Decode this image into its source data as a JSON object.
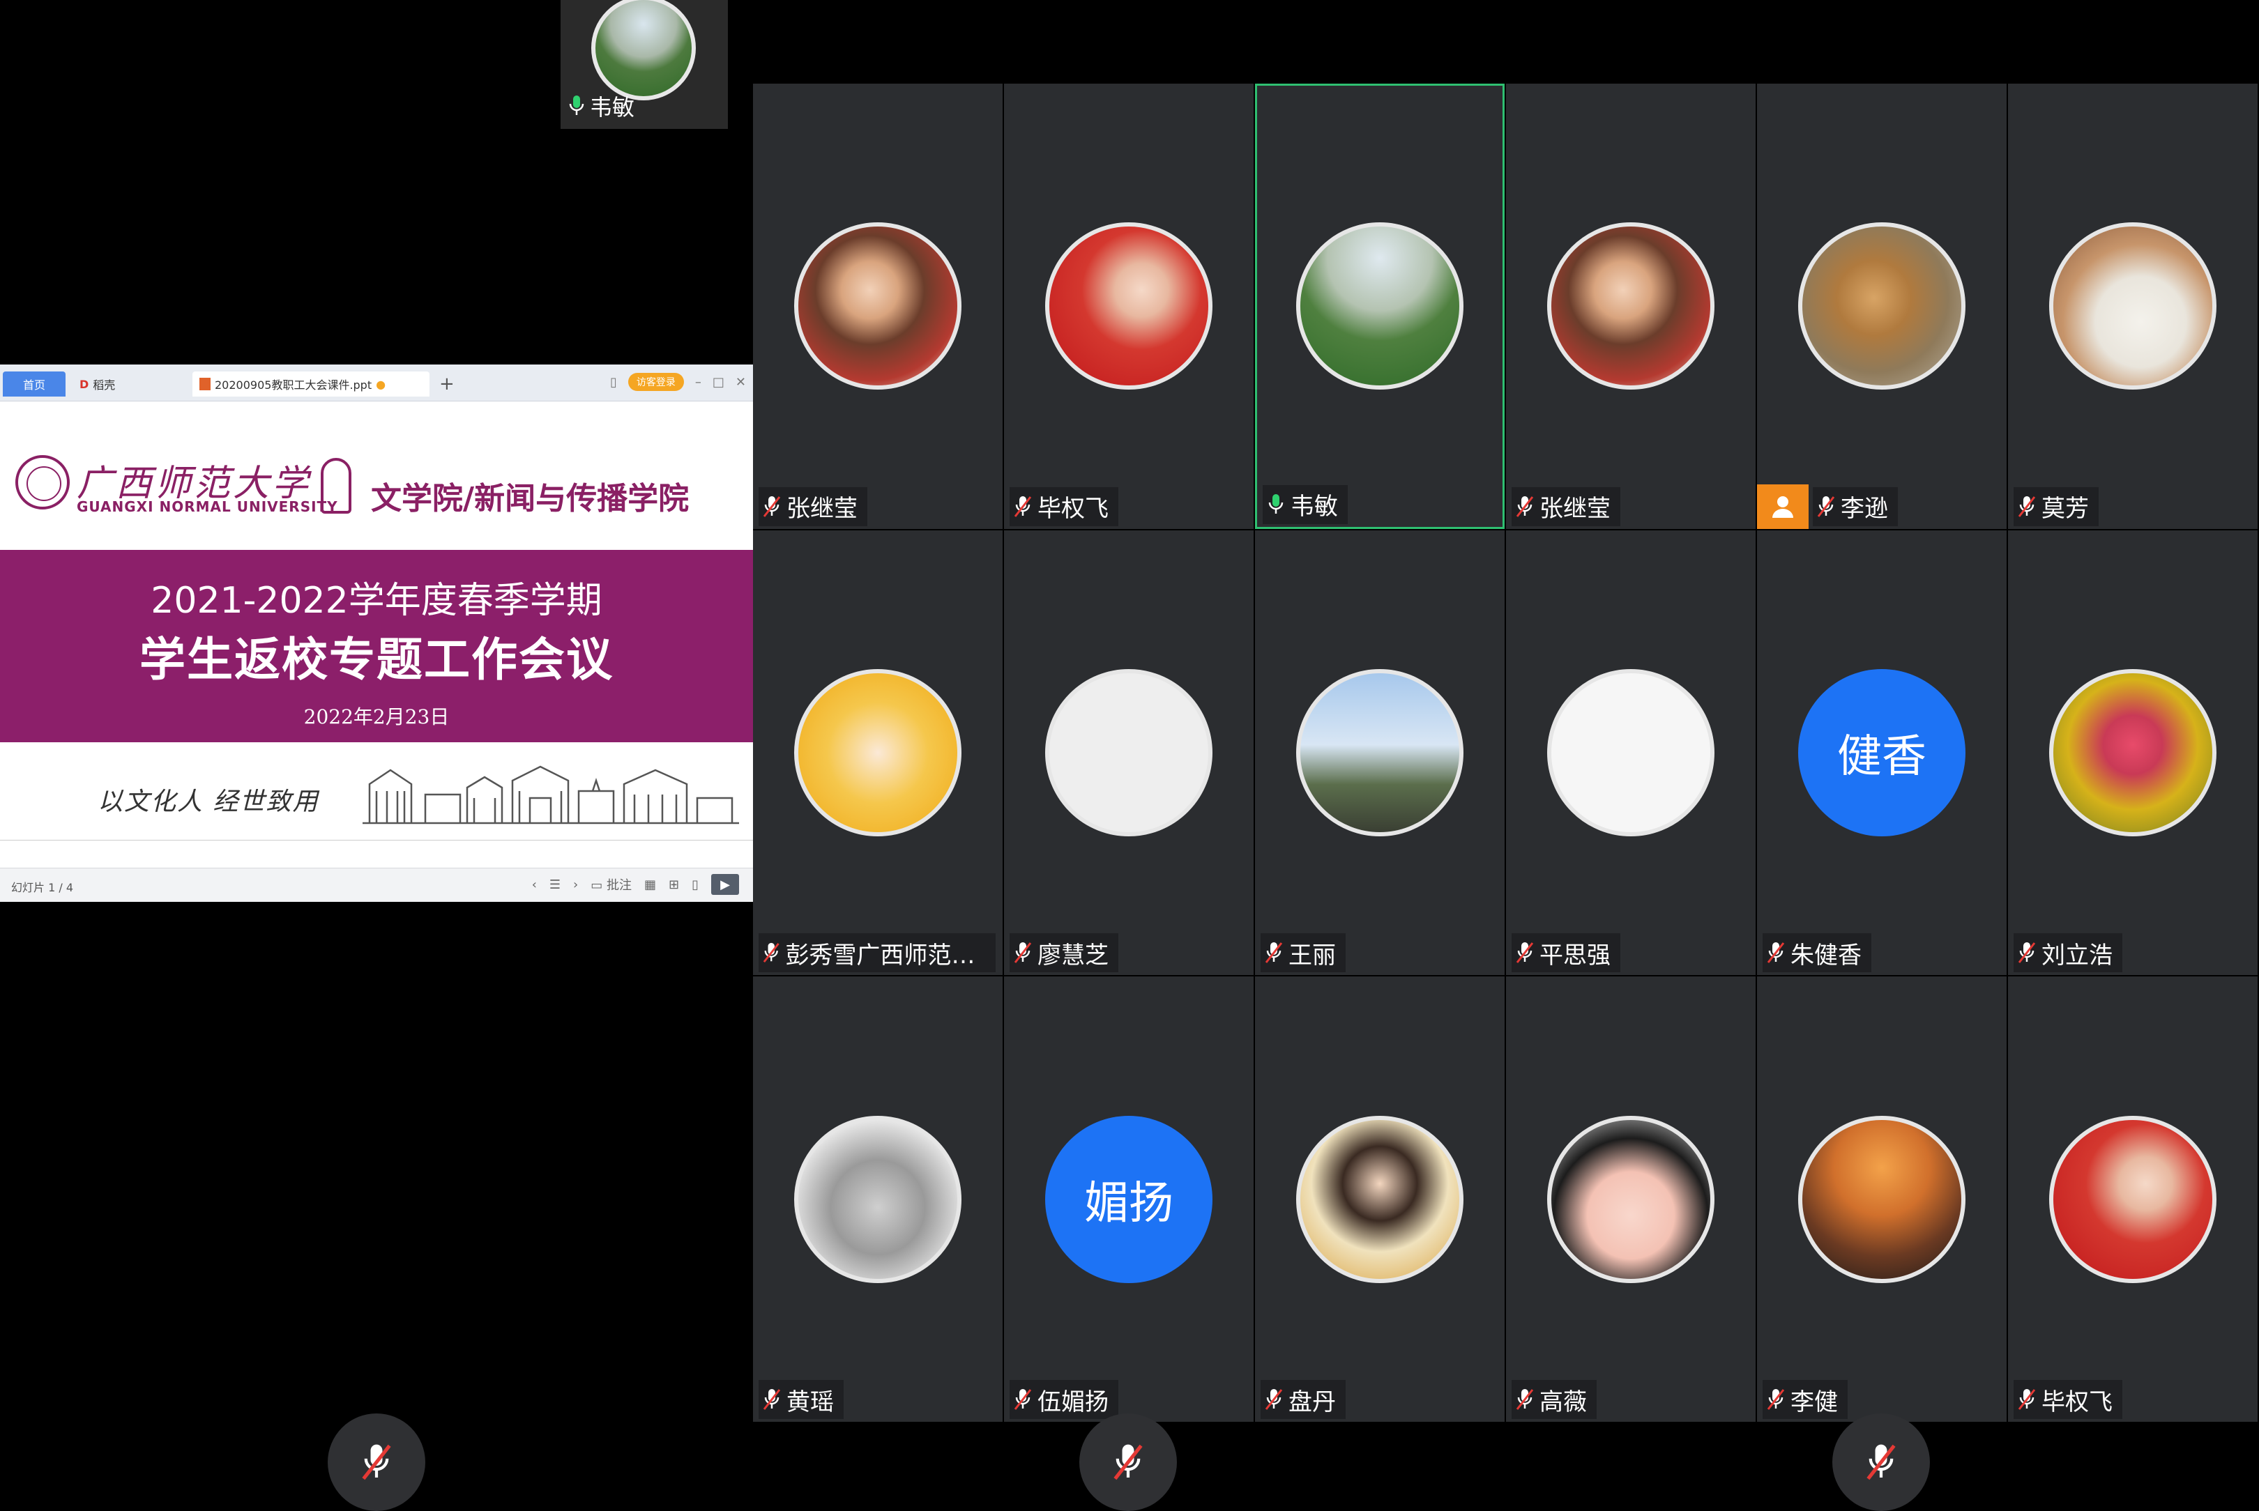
{
  "speaker_thumb": {
    "name": "韦敏"
  },
  "shared_window": {
    "tabs": {
      "home": "首页",
      "shell": "稻壳",
      "file": "20200905教职工大会课件.ppt",
      "plus": "+"
    },
    "guest_login": "访客登录",
    "slide": {
      "univ_cn": "广西师范大学",
      "univ_en": "GUANGXI NORMAL UNIVERSITY",
      "college": "文学院/新闻与传播学院",
      "term": "2021-2022学年度春季学期",
      "title": "学生返校专题工作会议",
      "date": "2022年2月23日",
      "slogan": "以文化人  经世致用"
    },
    "status": {
      "slide_count": "幻灯片 1 / 4",
      "notes": "批注"
    }
  },
  "participants": [
    {
      "name": "张继莹",
      "avatar": "selfie",
      "mic": "muted"
    },
    {
      "name": "毕权飞",
      "avatar": "flag",
      "mic": "muted"
    },
    {
      "name": "韦敏",
      "avatar": "hill",
      "mic": "on",
      "active": true
    },
    {
      "name": "张继莹",
      "avatar": "selfie",
      "mic": "muted"
    },
    {
      "name": "李逊",
      "avatar": "giraffe",
      "mic": "muted",
      "badge": "person"
    },
    {
      "name": "莫芳",
      "avatar": "bear",
      "mic": "muted"
    },
    {
      "name": "彭秀雪广西师范大学",
      "avatar": "cartoon-yellow",
      "mic": "muted"
    },
    {
      "name": "廖慧芝",
      "avatar": "face",
      "mic": "muted"
    },
    {
      "name": "王丽",
      "avatar": "sky",
      "mic": "muted"
    },
    {
      "name": "平思强",
      "avatar": "sketch",
      "mic": "muted"
    },
    {
      "name": "朱健香",
      "avatar_text": "健香",
      "mic": "muted"
    },
    {
      "name": "刘立浩",
      "avatar": "couple",
      "mic": "muted"
    },
    {
      "name": "黄瑶",
      "avatar": "raccoon",
      "mic": "muted"
    },
    {
      "name": "伍媚扬",
      "avatar_text": "媚扬",
      "mic": "muted"
    },
    {
      "name": "盘丹",
      "avatar": "girl",
      "mic": "muted"
    },
    {
      "name": "高薇",
      "avatar": "maruko",
      "mic": "muted"
    },
    {
      "name": "李健",
      "avatar": "sunset",
      "mic": "muted"
    },
    {
      "name": "毕权飞",
      "avatar": "flag",
      "mic": "muted"
    }
  ],
  "bottom_controls": [
    "mic-muted-button",
    "mic-muted-button",
    "mic-muted-button"
  ],
  "colors": {
    "active_border": "#2fbf71",
    "text_avatar": "#1d73f5",
    "badge": "#f28a1b",
    "slide_band": "#8c1f6a"
  }
}
